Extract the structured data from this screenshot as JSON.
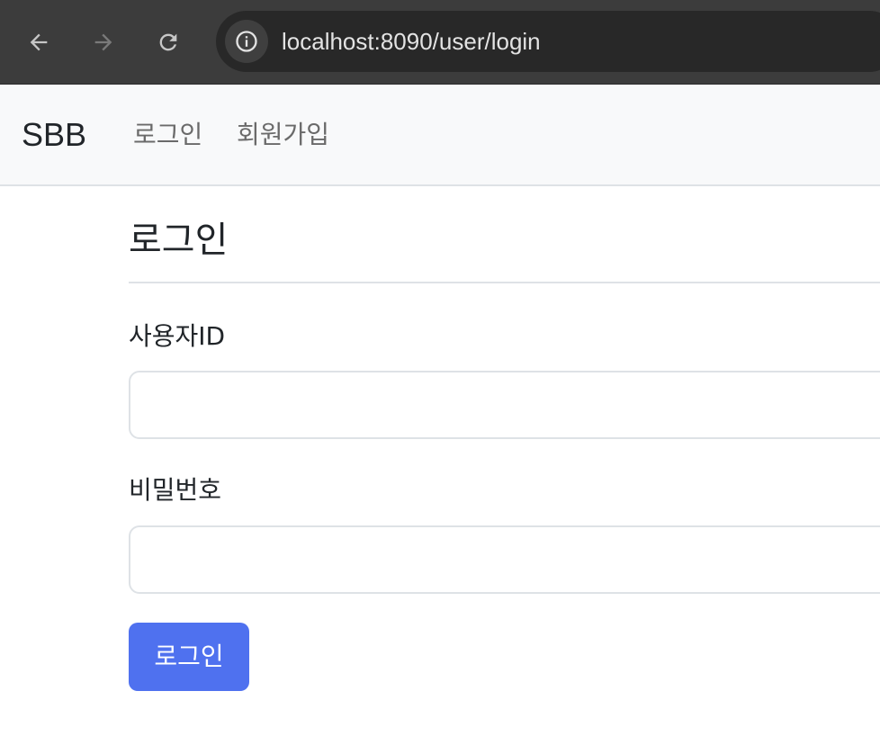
{
  "browser": {
    "url": "localhost:8090/user/login",
    "icons": {
      "back": "arrow-left-icon",
      "forward": "arrow-right-icon",
      "reload": "reload-icon",
      "site_info": "info-icon"
    }
  },
  "navbar": {
    "brand": "SBB",
    "links": [
      {
        "label": "로그인"
      },
      {
        "label": "회원가입"
      }
    ]
  },
  "main": {
    "title": "로그인",
    "fields": [
      {
        "label": "사용자ID",
        "value": "",
        "placeholder": ""
      },
      {
        "label": "비밀번호",
        "value": "",
        "placeholder": ""
      }
    ],
    "submit_label": "로그인"
  },
  "colors": {
    "chrome_bg": "#3c3c3c",
    "navbar_bg": "#f8f9fa",
    "primary_button": "#4f71ef",
    "border": "#dee2e6"
  }
}
